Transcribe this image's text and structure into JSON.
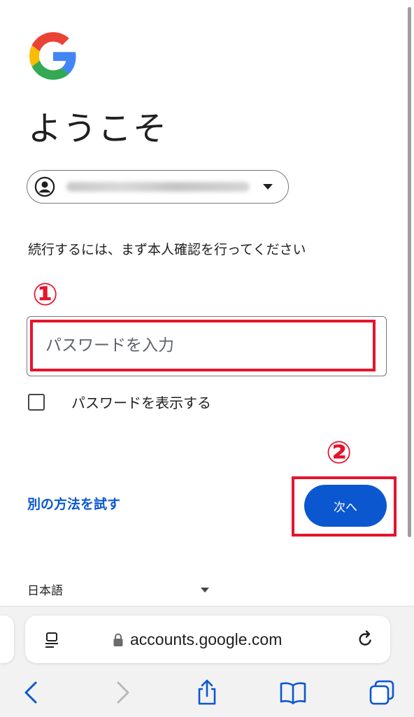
{
  "colors": {
    "accent": "#0b57d0",
    "annotation_red": "#e5142d",
    "text": "#1f1f1f"
  },
  "logo": {
    "icon": "google-g-logo"
  },
  "page": {
    "title": "ようこそ",
    "account_chip": {
      "icon": "account-circle-icon",
      "email": "(blurred)",
      "caret_icon": "dropdown-caret-icon"
    },
    "instruction": "続行するには、まず本人確認を行ってください",
    "password": {
      "placeholder": "パスワードを入力",
      "value": ""
    },
    "show_password_label": "パスワードを表示する",
    "show_password_checked": false,
    "try_another_link": "別の方法を試す",
    "next_button": "次へ",
    "language": "日本語"
  },
  "annotations": {
    "step1": "①",
    "step2": "②"
  },
  "browser": {
    "url": "accounts.google.com",
    "icons": [
      "reader-icon",
      "lock-icon",
      "reload-icon",
      "back-icon",
      "forward-icon",
      "share-icon",
      "bookmarks-icon",
      "tabs-icon"
    ]
  }
}
